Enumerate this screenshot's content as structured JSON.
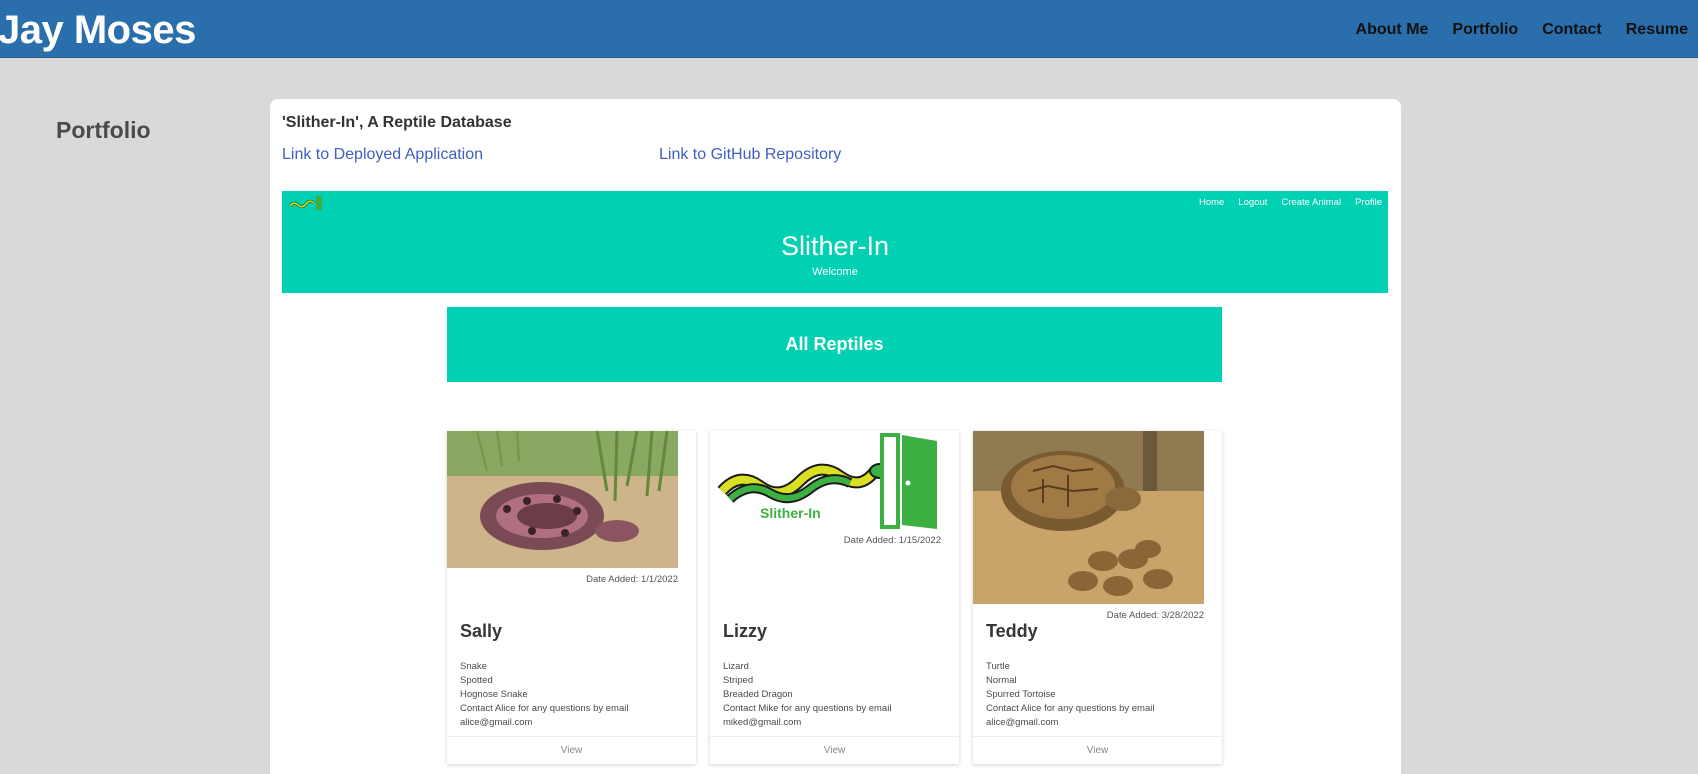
{
  "header": {
    "title": "Jay Moses",
    "nav": [
      "About Me",
      "Portfolio",
      "Contact",
      "Resume"
    ]
  },
  "section": {
    "heading": "Portfolio"
  },
  "project": {
    "title": "'Slither-In', A Reptile Database",
    "deployed_link": "Link to Deployed Application",
    "github_link": "Link to GitHub Repository"
  },
  "app": {
    "nav": [
      "Home",
      "Logout",
      "Create Animal",
      "Profile"
    ],
    "title": "Slither-In",
    "subtitle": "Welcome",
    "banner": "All Reptiles",
    "logo_text": "Slither-In",
    "cards": [
      {
        "name": "Sally",
        "date": "Date Added: 1/1/2022",
        "details": [
          "Snake",
          "Spotted",
          "Hognose Snake",
          "Contact Alice for any questions by email",
          "alice@gmail.com"
        ],
        "footer": "View"
      },
      {
        "name": "Lizzy",
        "date": "Date Added: 1/15/2022",
        "details": [
          "Lizard",
          "Striped",
          "Breaded Dragon",
          "Contact Mike for any questions by email",
          "miked@gmail.com"
        ],
        "footer": "View"
      },
      {
        "name": "Teddy",
        "date": "Date Added: 3/28/2022",
        "details": [
          "Turtle",
          "Normal",
          "Spurred Tortoise",
          "Contact Alice for any questions by email",
          "alice@gmail.com"
        ],
        "footer": "View"
      }
    ]
  },
  "colors": {
    "header_bg": "#2a6eab",
    "page_bg": "#d9d9d9",
    "link": "#3e5fc0",
    "app_accent": "#00d1b2",
    "logo_green": "#3cb043",
    "logo_snake": "#d9e021"
  }
}
